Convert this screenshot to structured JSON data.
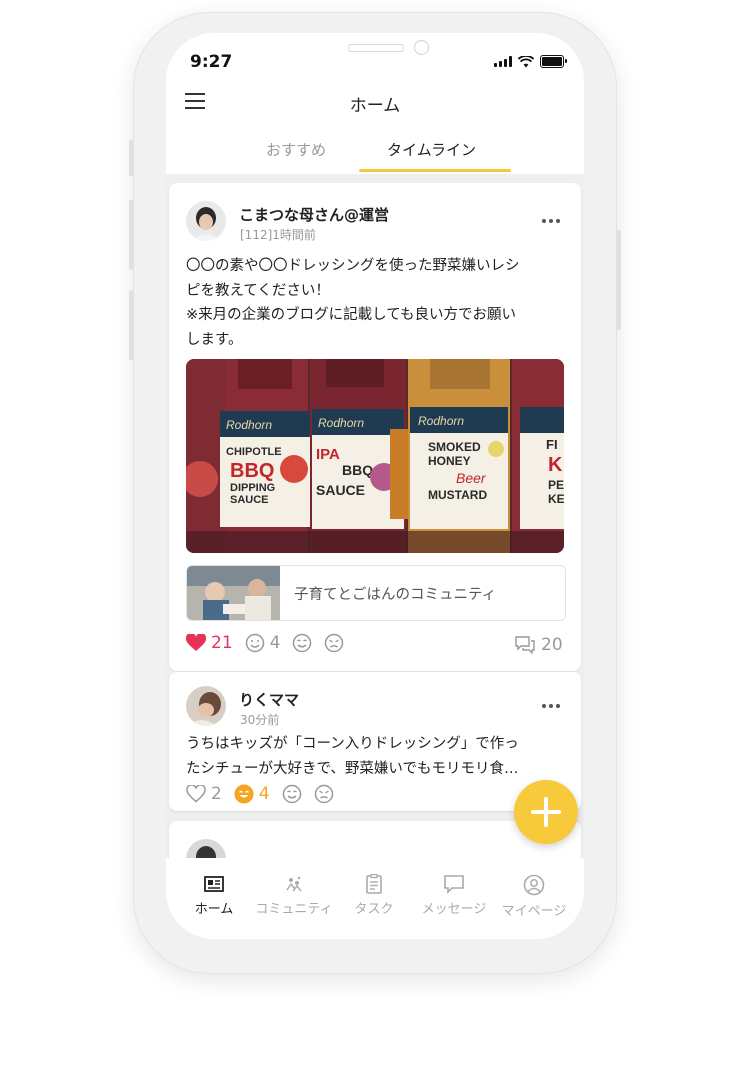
{
  "status": {
    "time": "9:27"
  },
  "header": {
    "title": "ホーム"
  },
  "tabs": [
    {
      "label": "おすすめ",
      "active": false
    },
    {
      "label": "タイムライン",
      "active": true
    }
  ],
  "posts": [
    {
      "user": "こまつな母さん@運営",
      "meta": "[112]1時間前",
      "text_lines": [
        "〇〇の素や〇〇ドレッシングを使った野菜嫌いレシ",
        "ピを教えてください！",
        "※来月の企業のブログに記載しても良い方でお願い",
        "します。"
      ],
      "image_labels": {
        "b1": [
          "CHIPOTLE",
          "BBQ",
          "DIPPING",
          "SAUCE"
        ],
        "b2": [
          "IPA",
          "BBQ",
          "SAUCE"
        ],
        "b3": [
          "SMOKED",
          "HONEY",
          "Beer",
          "MUSTARD"
        ],
        "b4": [
          "FI",
          "K",
          "PE",
          "KE"
        ],
        "brand": "Rodhorn"
      },
      "community": "子育てとごはんのコミュニティ",
      "likes": "21",
      "smile": "4",
      "comments": "20"
    },
    {
      "user": "りくママ",
      "meta": "30分前",
      "text_lines": [
        "うちはキッズが「コーン入りドレッシング」で作っ",
        "たシチューが大好きで、野菜嫌いでもモリモリ食…"
      ],
      "likes": "2",
      "smile": "4"
    }
  ],
  "nav": [
    {
      "label": "ホーム",
      "icon": "home-news-icon",
      "active": true
    },
    {
      "label": "コミュニティ",
      "icon": "community-icon",
      "active": false
    },
    {
      "label": "タスク",
      "icon": "task-clipboard-icon",
      "active": false
    },
    {
      "label": "メッセージ",
      "icon": "message-bubble-icon",
      "active": false
    },
    {
      "label": "マイページ",
      "icon": "profile-user-icon",
      "active": false
    }
  ],
  "colors": {
    "accent": "#f5c93a",
    "like": "#e8325a",
    "smile": "#f4a623",
    "feed_bg": "#efefef"
  }
}
